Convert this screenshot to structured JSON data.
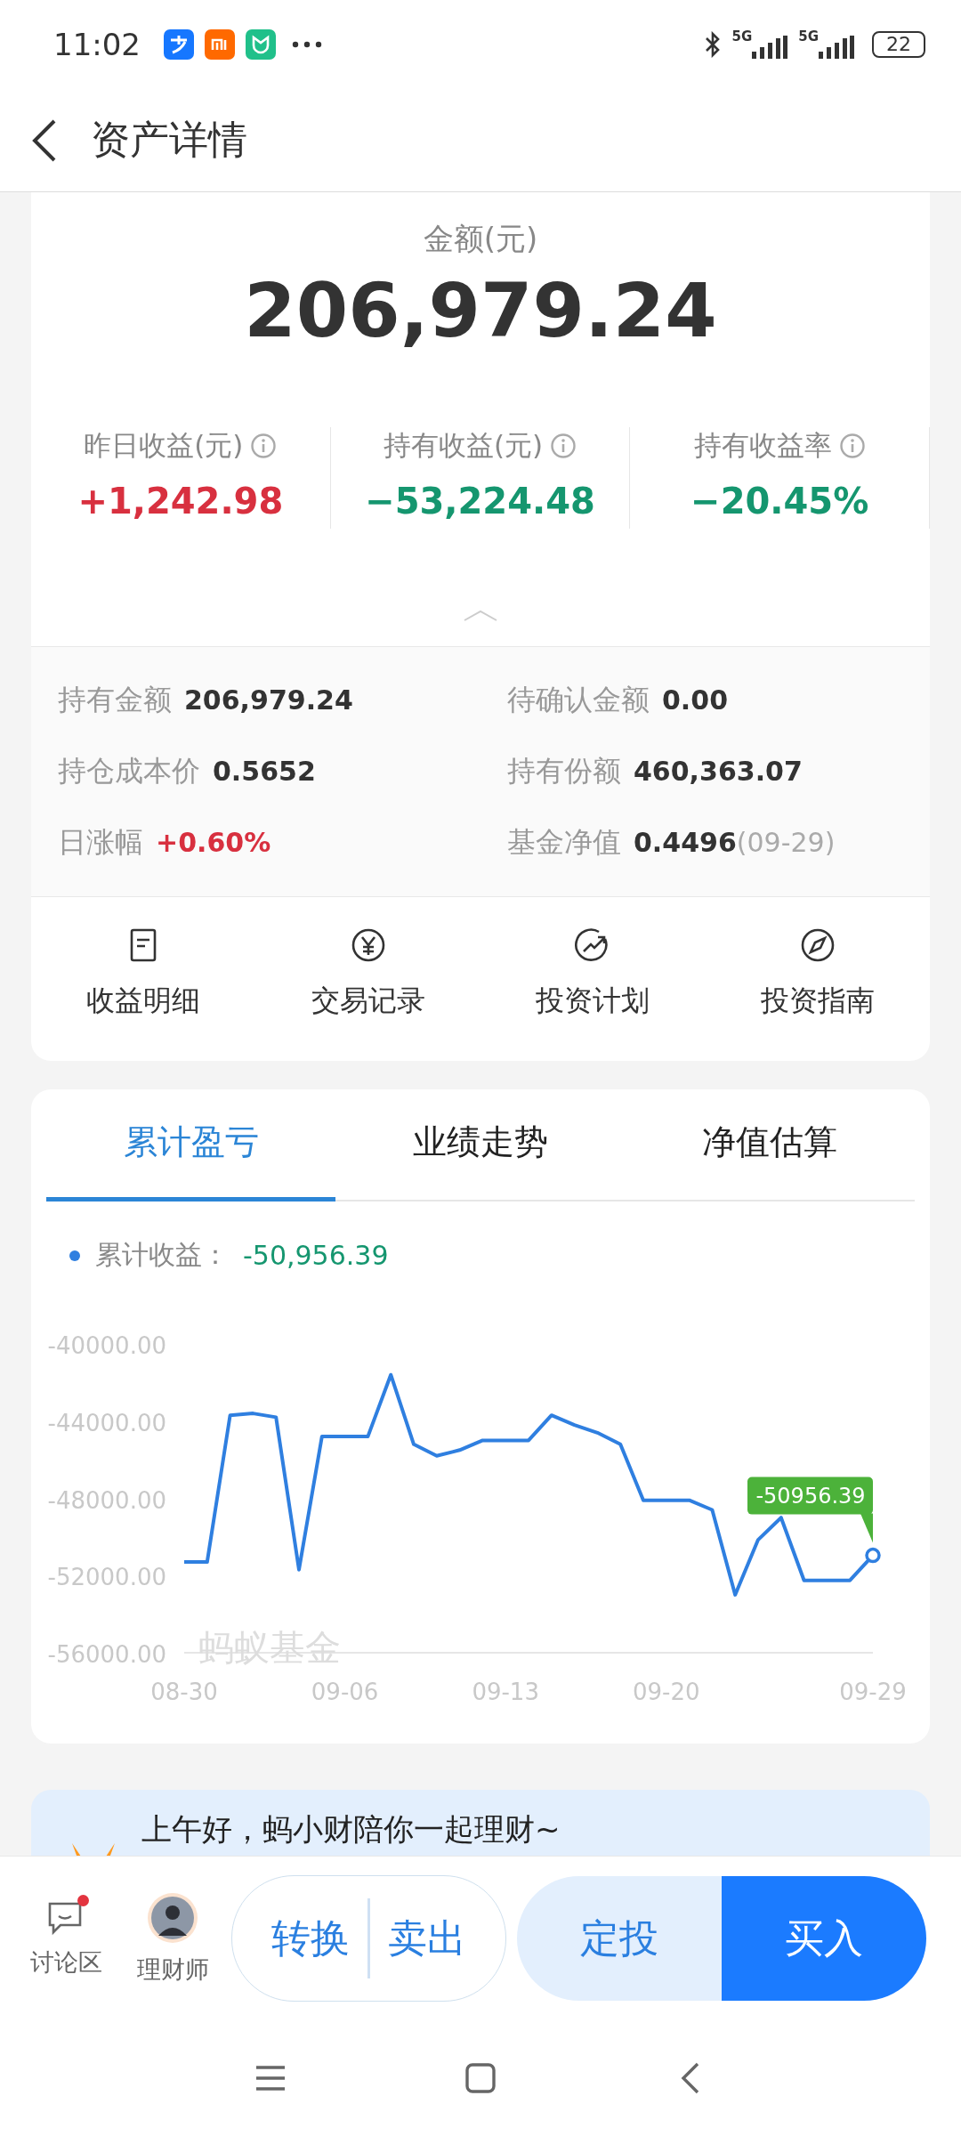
{
  "status_bar": {
    "time": "11:02",
    "signals": [
      "5G",
      "5G"
    ],
    "battery": "22"
  },
  "header": {
    "title": "资产详情"
  },
  "summary": {
    "label": "金额(元)",
    "amount": "206,979.24",
    "stats": [
      {
        "label": "昨日收益(元)",
        "value": "+1,242.98",
        "color": "#d8303f"
      },
      {
        "label": "持有收益(元)",
        "value": "−53,224.48",
        "color": "#15966f"
      },
      {
        "label": "持有收益率",
        "value": "−20.45%",
        "color": "#15966f"
      }
    ]
  },
  "details": [
    {
      "label": "持有金额",
      "value": "206,979.24"
    },
    {
      "label": "待确认金额",
      "value": "0.00"
    },
    {
      "label": "持仓成本价",
      "value": "0.5652"
    },
    {
      "label": "持有份额",
      "value": "460,363.07"
    },
    {
      "label": "日涨幅",
      "value": "+0.60%",
      "color": "#d8303f"
    },
    {
      "label": "基金净值",
      "value": "0.4496",
      "note": "(09-29)"
    }
  ],
  "actions": [
    {
      "label": "收益明细",
      "kind": "document"
    },
    {
      "label": "交易记录",
      "kind": "yen"
    },
    {
      "label": "投资计划",
      "kind": "growth"
    },
    {
      "label": "投资指南",
      "kind": "compass"
    }
  ],
  "chart_card": {
    "tabs": [
      {
        "label": "累计盈亏",
        "selected": true
      },
      {
        "label": "业绩走势",
        "selected": false
      },
      {
        "label": "净值估算",
        "selected": false
      }
    ],
    "legend": {
      "label": "累计收益：",
      "value": "-50,956.39",
      "color": "#15966f"
    },
    "watermark": "蚂蚁基金",
    "tooltip": "-50956.39",
    "chart_data": {
      "type": "line",
      "categories": [
        "08-30",
        null,
        null,
        null,
        null,
        null,
        null,
        "09-06",
        null,
        null,
        null,
        null,
        null,
        null,
        "09-13",
        null,
        null,
        null,
        null,
        null,
        null,
        "09-20",
        null,
        null,
        null,
        null,
        null,
        null,
        null,
        null,
        "09-29"
      ],
      "series": [
        {
          "color": "#2f7fe0",
          "values": [
            -51300,
            -51300,
            -43700,
            -43600,
            -43800,
            -51700,
            -44800,
            -44800,
            -44800,
            -41600,
            -45200,
            -45800,
            -45500,
            -45000,
            -45000,
            -45000,
            -43700,
            -44200,
            -44600,
            -45200,
            -48100,
            -48100,
            -48100,
            -48600,
            -53000,
            -50150,
            -49000,
            -52250,
            -52250,
            -52250,
            -50956.39
          ]
        }
      ],
      "ylim": [
        -56000,
        -40000
      ],
      "yticks": [
        {
          "value": -40000,
          "label": "-40000.00"
        },
        {
          "value": -44000,
          "label": "-44000.00"
        },
        {
          "value": -48000,
          "label": "-48000.00"
        },
        {
          "value": -52000,
          "label": "-52000.00"
        },
        {
          "value": -56000,
          "label": "-56000.00"
        }
      ]
    }
  },
  "banner": {
    "text": "上午好，蚂小财陪你一起理财~"
  },
  "bottom_bar": {
    "links": [
      {
        "label": "讨论区",
        "kind": "chat",
        "badge": true
      },
      {
        "label": "理财师",
        "kind": "avatar",
        "badge": false
      }
    ],
    "buttons": [
      {
        "label": "转换",
        "kind": "outline"
      },
      {
        "label": "卖出",
        "kind": "outline"
      },
      {
        "label": "定投",
        "kind": "light"
      },
      {
        "label": "买入",
        "kind": "primary"
      }
    ]
  }
}
